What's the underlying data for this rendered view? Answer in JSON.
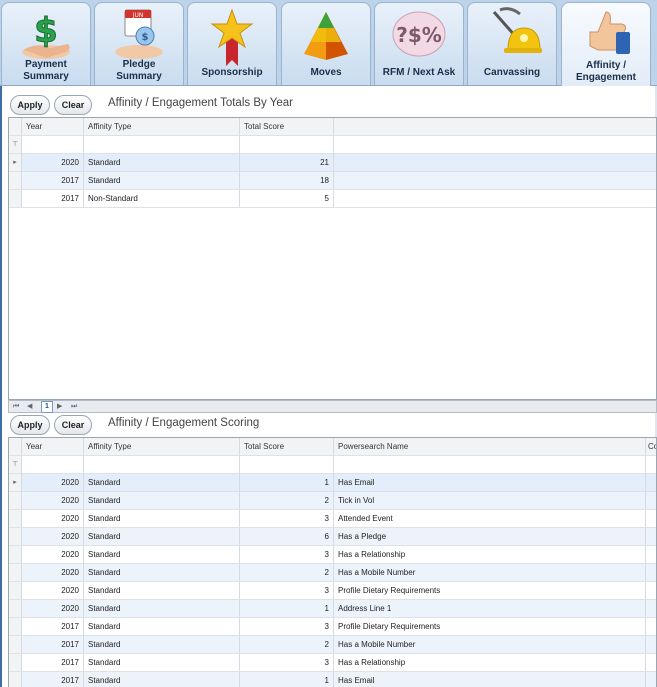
{
  "tabs": [
    {
      "label": "Payment\nSummary",
      "icon": "money-hand-icon"
    },
    {
      "label": "Pledge\nSummary",
      "icon": "calendar-hand-icon"
    },
    {
      "label": "Sponsorship",
      "icon": "star-ribbon-icon"
    },
    {
      "label": "Moves",
      "icon": "pyramid-icon"
    },
    {
      "label": "RFM / Next Ask",
      "icon": "rfm-bubble-icon"
    },
    {
      "label": "Canvassing",
      "icon": "pickaxe-helmet-icon"
    },
    {
      "label": "Affinity /\nEngagement",
      "icon": "thumbs-up-icon"
    }
  ],
  "calendar_text": "JUN",
  "rfm_text": "?$%",
  "active_tab": "Affinity /\nEngagement",
  "apply_label": "Apply",
  "clear_label": "Clear",
  "totals": {
    "title": "Affinity / Engagement Totals By Year",
    "columns": [
      "Year",
      "Affinity Type",
      "Total Score"
    ],
    "rows": [
      {
        "year": "2020",
        "type": "Standard",
        "score": "21"
      },
      {
        "year": "2017",
        "type": "Standard",
        "score": "18"
      },
      {
        "year": "2017",
        "type": "Non-Standard",
        "score": "5"
      }
    ],
    "pager": {
      "first": "⏮",
      "prev": "◀",
      "page": "1",
      "next": "▶",
      "last": "⏭"
    }
  },
  "scoring": {
    "title": "Affinity / Engagement Scoring",
    "columns": [
      "Year",
      "Affinity Type",
      "Total Score",
      "Powersearch Name",
      "Co"
    ],
    "rows": [
      {
        "year": "2020",
        "type": "Standard",
        "score": "1",
        "name": "Has Email"
      },
      {
        "year": "2020",
        "type": "Standard",
        "score": "2",
        "name": "Tick in Vol"
      },
      {
        "year": "2020",
        "type": "Standard",
        "score": "3",
        "name": "Attended Event"
      },
      {
        "year": "2020",
        "type": "Standard",
        "score": "6",
        "name": "Has a Pledge"
      },
      {
        "year": "2020",
        "type": "Standard",
        "score": "3",
        "name": "Has a Relationship"
      },
      {
        "year": "2020",
        "type": "Standard",
        "score": "2",
        "name": "Has a Mobile Number"
      },
      {
        "year": "2020",
        "type": "Standard",
        "score": "3",
        "name": "Profile Dietary Requirements"
      },
      {
        "year": "2020",
        "type": "Standard",
        "score": "1",
        "name": "Address Line 1"
      },
      {
        "year": "2017",
        "type": "Standard",
        "score": "3",
        "name": "Profile Dietary Requirements"
      },
      {
        "year": "2017",
        "type": "Standard",
        "score": "2",
        "name": "Has a Mobile Number"
      },
      {
        "year": "2017",
        "type": "Standard",
        "score": "3",
        "name": "Has a Relationship"
      },
      {
        "year": "2017",
        "type": "Standard",
        "score": "1",
        "name": "Has Email"
      }
    ]
  },
  "filter_icon": "filter-icon",
  "row_indicator_icon": "current-row-arrow-icon"
}
